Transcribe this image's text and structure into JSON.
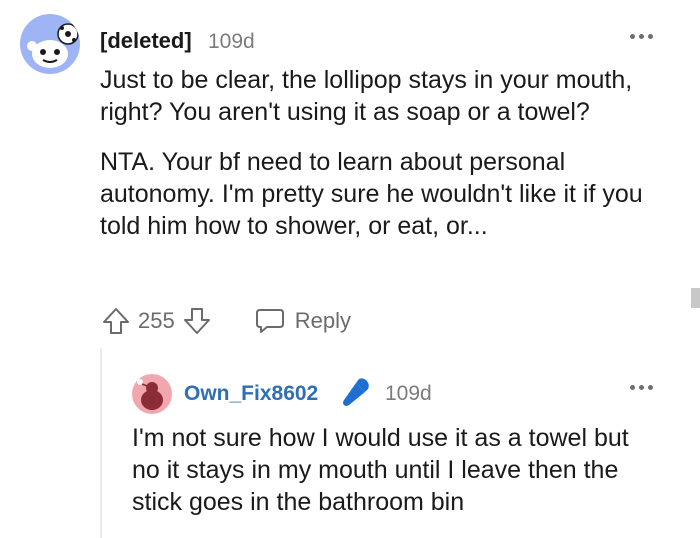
{
  "comment": {
    "author": "[deleted]",
    "age": "109d",
    "paragraphs": [
      "Just to be clear, the lollipop stays in your mouth, right? You aren't using it as soap or a towel?",
      "NTA. Your bf need to learn about personal autonomy. I'm pretty sure he wouldn't like it if you told him how to shower, or eat, or..."
    ],
    "score": "255",
    "reply_label": "Reply"
  },
  "reply": {
    "author": "Own_Fix8602",
    "age": "109d",
    "text": "I'm not sure how I would use it as a towel but no it stays in my mouth until I leave then the stick goes in the bathroom bin"
  },
  "icons": {
    "avatar_main": "snoo-avatar-icon",
    "avatar_reply": "snoo-avatar-icon",
    "upvote": "arrow-up-icon",
    "downvote": "arrow-down-icon",
    "reply": "speech-bubble-icon",
    "more": "more-horizontal-icon",
    "flair": "microphone-icon"
  },
  "colors": {
    "link_blue": "#2f6fb5",
    "meta_gray": "#7c7c7c",
    "avatar_main_bg": "#9fb4f5",
    "avatar_reply_bg": "#f2a7ae"
  }
}
